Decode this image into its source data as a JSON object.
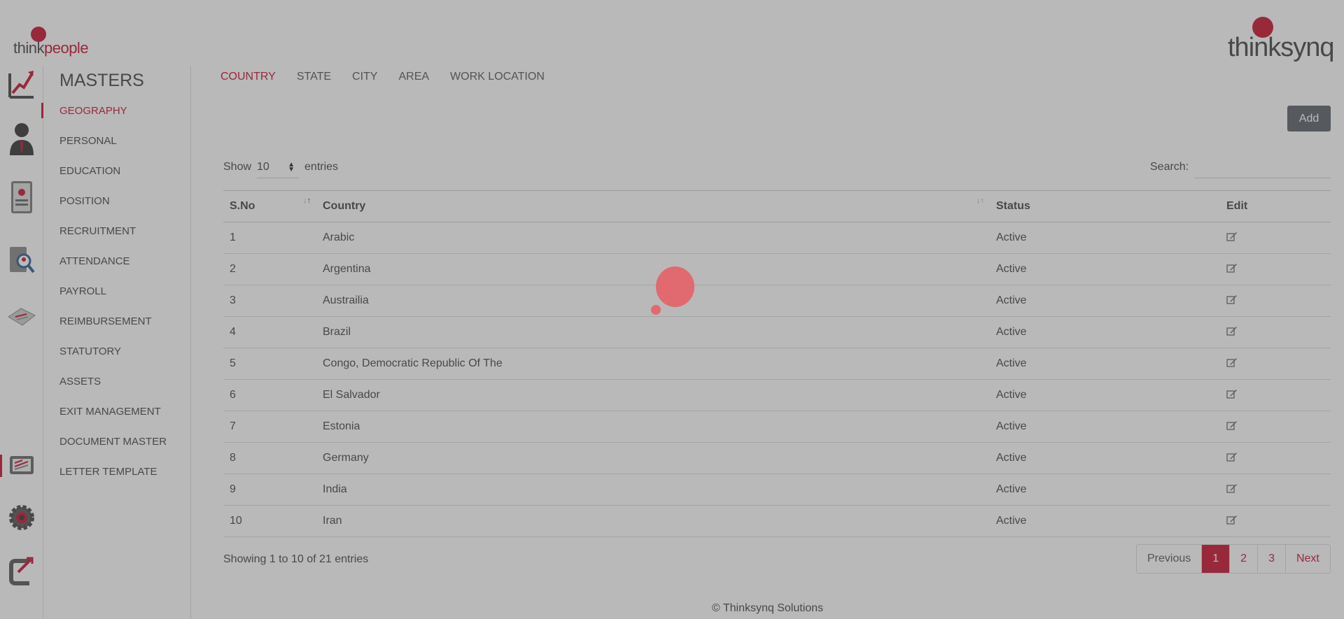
{
  "brand": {
    "left_logo_part1": "think",
    "left_logo_part2": "people",
    "right_logo": "thinksynq",
    "accent": "#c8102e"
  },
  "iconbar": [
    "analytics-icon",
    "employee-icon",
    "profile-document-icon",
    "search-person-icon",
    "letter-icon",
    "masters-icon",
    "settings-icon",
    "logout-icon"
  ],
  "sidebar": {
    "title": "MASTERS",
    "items": [
      "GEOGRAPHY",
      "PERSONAL",
      "EDUCATION",
      "POSITION",
      "RECRUITMENT",
      "ATTENDANCE",
      "PAYROLL",
      "REIMBURSEMENT",
      "STATUTORY",
      "ASSETS",
      "EXIT MANAGEMENT",
      "DOCUMENT MASTER",
      "LETTER TEMPLATE"
    ],
    "active": "GEOGRAPHY"
  },
  "tabs": [
    "COUNTRY",
    "STATE",
    "CITY",
    "AREA",
    "WORK LOCATION"
  ],
  "active_tab": "COUNTRY",
  "toolbar": {
    "add_label": "Add"
  },
  "length": {
    "show": "Show",
    "value": "10",
    "entries": "entries"
  },
  "search": {
    "label": "Search:",
    "value": ""
  },
  "table": {
    "headers": [
      "S.No",
      "Country",
      "Status",
      "Edit"
    ],
    "rows": [
      [
        "1",
        "Arabic",
        "Active"
      ],
      [
        "2",
        "Argentina",
        "Active"
      ],
      [
        "3",
        "Austrailia",
        "Active"
      ],
      [
        "4",
        "Brazil",
        "Active"
      ],
      [
        "5",
        "Congo, Democratic Republic Of The",
        "Active"
      ],
      [
        "6",
        "El Salvador",
        "Active"
      ],
      [
        "7",
        "Estonia",
        "Active"
      ],
      [
        "8",
        "Germany",
        "Active"
      ],
      [
        "9",
        "India",
        "Active"
      ],
      [
        "10",
        "Iran",
        "Active"
      ]
    ]
  },
  "info": "Showing 1 to 10 of 21 entries",
  "pagination": {
    "previous": "Previous",
    "pages": [
      "1",
      "2",
      "3"
    ],
    "next": "Next",
    "current": "1"
  },
  "footer": "© Thinksynq Solutions"
}
